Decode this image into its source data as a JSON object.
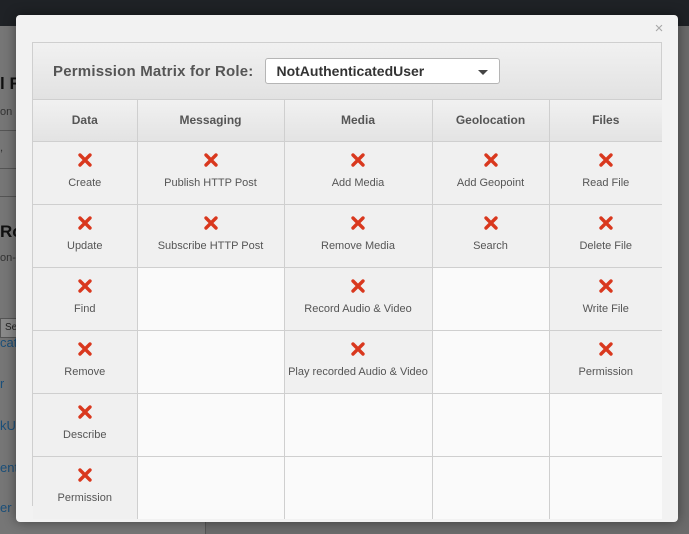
{
  "background": {
    "heading1": "l R",
    "text1": "on",
    "text2": ",",
    "heading2": "Ro",
    "text3": "on-",
    "button": "Se",
    "links": [
      "cat",
      "r",
      "kU",
      "enti",
      "er"
    ]
  },
  "modal": {
    "close_label": "×",
    "title": "Permission Matrix for Role:",
    "role": "NotAuthenticatedUser",
    "columns": [
      "Data",
      "Messaging",
      "Media",
      "Geolocation",
      "Files"
    ],
    "rows": [
      [
        "Create",
        "Publish HTTP Post",
        "Add Media",
        "Add Geopoint",
        "Read File"
      ],
      [
        "Update",
        "Subscribe HTTP Post",
        "Remove Media",
        "Search",
        "Delete File"
      ],
      [
        "Find",
        "",
        "Record Audio & Video",
        "",
        "Write File"
      ],
      [
        "Remove",
        "",
        "Play recorded Audio & Video",
        "",
        "Permission"
      ],
      [
        "Describe",
        "",
        "",
        "",
        ""
      ],
      [
        "Permission",
        "",
        "",
        "",
        ""
      ]
    ],
    "status_icon": "deny-x-icon",
    "deny_color": "#d9381e"
  }
}
